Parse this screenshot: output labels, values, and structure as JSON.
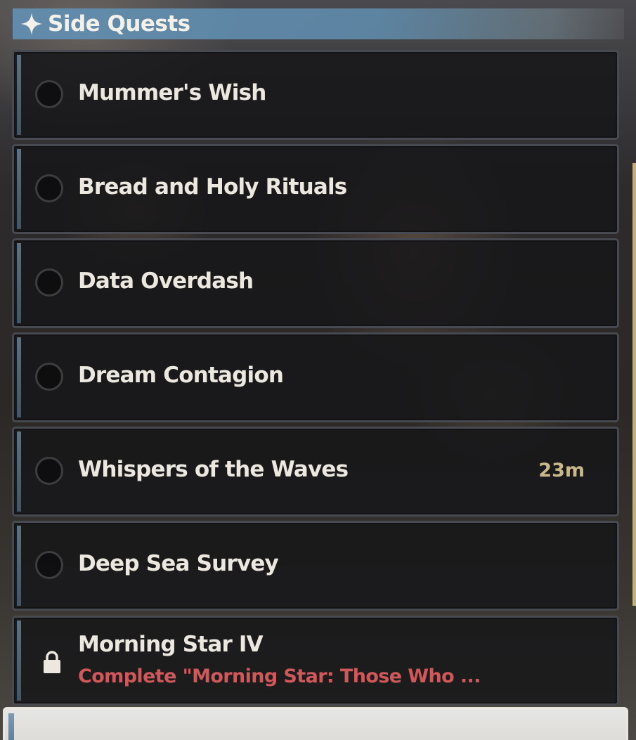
{
  "header": {
    "title": "Side Quests",
    "icon": "four-point-star-icon"
  },
  "quests": [
    {
      "name": "Mummer's Wish",
      "status_icon": "empty-circle-icon"
    },
    {
      "name": "Bread and Holy Rituals",
      "status_icon": "empty-circle-icon"
    },
    {
      "name": "Data Overdash",
      "status_icon": "empty-circle-icon"
    },
    {
      "name": "Dream Contagion",
      "status_icon": "empty-circle-icon"
    },
    {
      "name": "Whispers of the Waves",
      "status_icon": "empty-circle-icon",
      "timer": "23m"
    },
    {
      "name": "Deep Sea Survey",
      "status_icon": "empty-circle-icon"
    },
    {
      "name": "Morning Star IV",
      "status_icon": "lock-icon",
      "requirement": "Complete \"Morning Star: Those Who ..."
    }
  ],
  "colors": {
    "header_bg": "#628eb0",
    "quest_text": "#ece8df",
    "timer_text": "#c8b88a",
    "locked_requirement_text": "#d0585a",
    "scroll_accent": "#d8c58c"
  }
}
